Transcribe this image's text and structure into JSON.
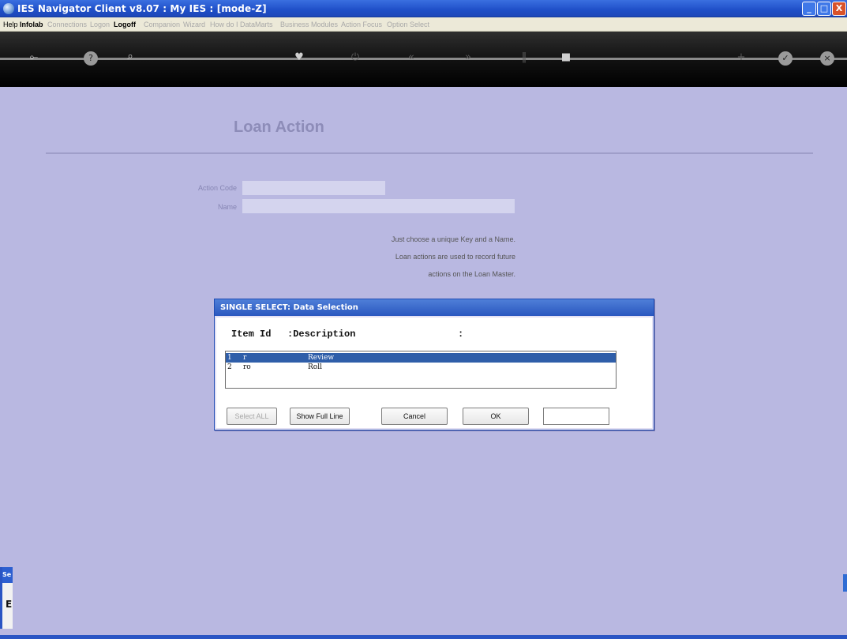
{
  "window": {
    "title": "IES Navigator Client v8.07 : My IES :      [mode-Z]",
    "minimize_label": "_",
    "maximize_label": "□",
    "close_label": "X"
  },
  "menu": {
    "items": [
      {
        "label": "Help",
        "state": "active"
      },
      {
        "label": "Infolab",
        "state": "bold"
      },
      {
        "label": "Connections",
        "state": "disabled"
      },
      {
        "label": "Logon",
        "state": "disabled"
      },
      {
        "label": "Logoff",
        "state": "bold"
      },
      {
        "label": "Companion",
        "state": "disabled"
      },
      {
        "label": "Wizard",
        "state": "disabled"
      },
      {
        "label": "How do I",
        "state": "disabled"
      },
      {
        "label": "DataMarts",
        "state": "disabled"
      },
      {
        "label": "Business Modules",
        "state": "disabled"
      },
      {
        "label": "Action Focus",
        "state": "disabled"
      },
      {
        "label": "Option Select",
        "state": "disabled"
      }
    ]
  },
  "toolbar": {
    "icons": [
      {
        "name": "key-icon",
        "glyph": "⟜"
      },
      {
        "name": "help-icon",
        "glyph": "?"
      },
      {
        "name": "search-icon",
        "glyph": "⌕"
      },
      {
        "name": "heart-icon",
        "glyph": "♥"
      },
      {
        "name": "power-icon",
        "glyph": "⏻"
      },
      {
        "name": "rewind-icon",
        "glyph": "«"
      },
      {
        "name": "fast-forward-icon",
        "glyph": "»"
      },
      {
        "name": "pause-icon",
        "glyph": "‖"
      },
      {
        "name": "stop-icon",
        "glyph": "■"
      },
      {
        "name": "add-icon",
        "glyph": "+"
      },
      {
        "name": "check-icon",
        "glyph": "✓"
      },
      {
        "name": "close-icon",
        "glyph": "×"
      }
    ]
  },
  "form": {
    "title": "Loan Action",
    "fields": {
      "action_code_label": "Action Code",
      "action_code_value": "",
      "name_label": "Name",
      "name_value": ""
    },
    "hint_lines": [
      "Just choose a unique Key and a Name.",
      "Loan actions are used to record future",
      "actions on the Loan Master."
    ]
  },
  "dialog": {
    "title": "SINGLE SELECT: Data Selection",
    "header_item_id": "Item Id",
    "header_description": ":Description",
    "header_extra": ":",
    "rows": [
      {
        "num": "1",
        "id": "r",
        "description": "Review",
        "selected": true
      },
      {
        "num": "2",
        "id": "ro",
        "description": "Roll",
        "selected": false
      }
    ],
    "buttons": {
      "select_all": "Select ALL",
      "show_full_line": "Show Full Line",
      "cancel": "Cancel",
      "ok": "OK"
    },
    "search_value": ""
  },
  "side_panel": {
    "tab_label": "Se",
    "letter": "E"
  },
  "colors": {
    "background": "#b9b8e1",
    "title_bar": "#1f4fc8",
    "selection": "#2f5ea9",
    "form_title": "#8d8cb8"
  }
}
